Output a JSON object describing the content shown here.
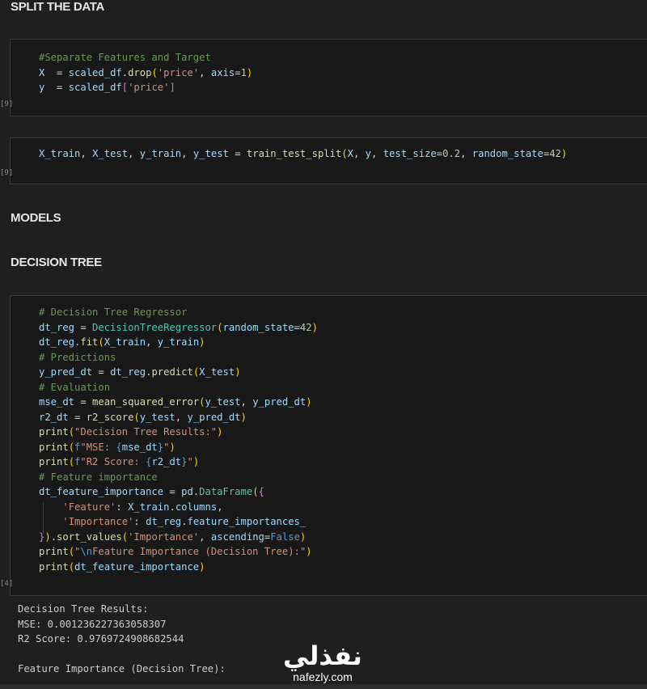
{
  "headings": {
    "split": "SPLIT THE DATA",
    "models": "MODELS",
    "decision_tree": "DECISION TREE"
  },
  "cells": [
    {
      "exec": "[9]",
      "lines": [
        [
          [
            "cm",
            "#Separate Features and Target"
          ]
        ],
        [
          [
            "vr",
            "X"
          ],
          [
            "",
            "  = "
          ],
          [
            "vr",
            "scaled_df"
          ],
          [
            "",
            "."
          ],
          [
            "fn",
            "drop"
          ],
          [
            "pn",
            "("
          ],
          [
            "st",
            "'price'"
          ],
          [
            "",
            ", "
          ],
          [
            "vr",
            "axis"
          ],
          [
            "",
            "="
          ],
          [
            "nm",
            "1"
          ],
          [
            "pn",
            ")"
          ]
        ],
        [
          [
            "vr",
            "y"
          ],
          [
            "",
            "  = "
          ],
          [
            "vr",
            "scaled_df"
          ],
          [
            "pn2",
            "["
          ],
          [
            "st",
            "'price'"
          ],
          [
            "pn2",
            "]"
          ]
        ]
      ]
    },
    {
      "exec": "[9]",
      "lines": [
        [
          [
            "vr",
            "X_train"
          ],
          [
            "",
            ", "
          ],
          [
            "vr",
            "X_test"
          ],
          [
            "",
            ", "
          ],
          [
            "vr",
            "y_train"
          ],
          [
            "",
            ", "
          ],
          [
            "vr",
            "y_test"
          ],
          [
            "",
            " = "
          ],
          [
            "fn",
            "train_test_split"
          ],
          [
            "pn",
            "("
          ],
          [
            "vr",
            "X"
          ],
          [
            "",
            ", "
          ],
          [
            "vr",
            "y"
          ],
          [
            "",
            ", "
          ],
          [
            "vr",
            "test_size"
          ],
          [
            "",
            "="
          ],
          [
            "nm",
            "0.2"
          ],
          [
            "",
            ", "
          ],
          [
            "vr",
            "random_state"
          ],
          [
            "",
            "="
          ],
          [
            "nm",
            "42"
          ],
          [
            "pn",
            ")"
          ]
        ]
      ]
    },
    {
      "exec": "[4]",
      "lines": [
        [
          [
            "cm",
            "# Decision Tree Regressor"
          ]
        ],
        [
          [
            "vr",
            "dt_reg"
          ],
          [
            "",
            " = "
          ],
          [
            "cls",
            "DecisionTreeRegressor"
          ],
          [
            "pn",
            "("
          ],
          [
            "vr",
            "random_state"
          ],
          [
            "",
            "="
          ],
          [
            "nm",
            "42"
          ],
          [
            "pn",
            ")"
          ]
        ],
        [
          [
            "vr",
            "dt_reg"
          ],
          [
            "",
            "."
          ],
          [
            "fn",
            "fit"
          ],
          [
            "pn",
            "("
          ],
          [
            "vr",
            "X_train"
          ],
          [
            "",
            ", "
          ],
          [
            "vr",
            "y_train"
          ],
          [
            "pn",
            ")"
          ]
        ],
        [
          [
            "cm",
            "# Predictions"
          ]
        ],
        [
          [
            "vr",
            "y_pred_dt"
          ],
          [
            "",
            " = "
          ],
          [
            "vr",
            "dt_reg"
          ],
          [
            "",
            "."
          ],
          [
            "fn",
            "predict"
          ],
          [
            "pn",
            "("
          ],
          [
            "vr",
            "X_test"
          ],
          [
            "pn",
            ")"
          ]
        ],
        [
          [
            "cm",
            "# Evaluation"
          ]
        ],
        [
          [
            "vr",
            "mse_dt"
          ],
          [
            "",
            " = "
          ],
          [
            "fn",
            "mean_squared_error"
          ],
          [
            "pn",
            "("
          ],
          [
            "vr",
            "y_test"
          ],
          [
            "",
            ", "
          ],
          [
            "vr",
            "y_pred_dt"
          ],
          [
            "pn",
            ")"
          ]
        ],
        [
          [
            "vr",
            "r2_dt"
          ],
          [
            "",
            " = "
          ],
          [
            "fn",
            "r2_score"
          ],
          [
            "pn",
            "("
          ],
          [
            "vr",
            "y_test"
          ],
          [
            "",
            ", "
          ],
          [
            "vr",
            "y_pred_dt"
          ],
          [
            "pn",
            ")"
          ]
        ],
        [
          [
            "fn",
            "print"
          ],
          [
            "pn",
            "("
          ],
          [
            "st",
            "\"Decision Tree Results:\""
          ],
          [
            "pn",
            ")"
          ]
        ],
        [
          [
            "fn",
            "print"
          ],
          [
            "pn",
            "("
          ],
          [
            "kw",
            "f"
          ],
          [
            "st",
            "\"MSE: "
          ],
          [
            "kw",
            "{"
          ],
          [
            "vr",
            "mse_dt"
          ],
          [
            "kw",
            "}"
          ],
          [
            "st",
            "\""
          ],
          [
            "pn",
            ")"
          ]
        ],
        [
          [
            "fn",
            "print"
          ],
          [
            "pn",
            "("
          ],
          [
            "kw",
            "f"
          ],
          [
            "st",
            "\"R2 Score: "
          ],
          [
            "kw",
            "{"
          ],
          [
            "vr",
            "r2_dt"
          ],
          [
            "kw",
            "}"
          ],
          [
            "st",
            "\""
          ],
          [
            "pn",
            ")"
          ]
        ],
        [
          [
            "cm",
            "# Feature importance"
          ]
        ],
        [
          [
            "vr",
            "dt_feature_importance"
          ],
          [
            "",
            " = "
          ],
          [
            "vr",
            "pd"
          ],
          [
            "",
            "."
          ],
          [
            "cls",
            "DataFrame"
          ],
          [
            "pn",
            "("
          ],
          [
            "pn2",
            "{"
          ]
        ],
        [
          [
            "",
            "    "
          ],
          [
            "st",
            "'Feature'"
          ],
          [
            "",
            ": "
          ],
          [
            "vr",
            "X_train"
          ],
          [
            "",
            "."
          ],
          [
            "vr",
            "columns"
          ],
          [
            "",
            ","
          ]
        ],
        [
          [
            "",
            "    "
          ],
          [
            "st",
            "'Importance'"
          ],
          [
            "",
            ": "
          ],
          [
            "vr",
            "dt_reg"
          ],
          [
            "",
            "."
          ],
          [
            "vr",
            "feature_importances_"
          ]
        ],
        [
          [
            "pn2",
            "}"
          ],
          [
            "pn",
            ")"
          ],
          [
            "",
            "."
          ],
          [
            "fn",
            "sort_values"
          ],
          [
            "pn",
            "("
          ],
          [
            "st",
            "'Importance'"
          ],
          [
            "",
            ", "
          ],
          [
            "vr",
            "ascending"
          ],
          [
            "",
            "="
          ],
          [
            "kw",
            "False"
          ],
          [
            "pn",
            ")"
          ]
        ],
        [
          [
            "fn",
            "print"
          ],
          [
            "pn",
            "("
          ],
          [
            "st",
            "\""
          ],
          [
            "kw",
            "\\n"
          ],
          [
            "st",
            "Feature Importance (Decision Tree):\""
          ],
          [
            "pn",
            ")"
          ]
        ],
        [
          [
            "fn",
            "print"
          ],
          [
            "pn",
            "("
          ],
          [
            "vr",
            "dt_feature_importance"
          ],
          [
            "pn",
            ")"
          ]
        ]
      ]
    }
  ],
  "output": {
    "lines": [
      "Decision Tree Results:",
      "MSE: 0.001236227363058307",
      "R2 Score: 0.9769724908682544",
      "",
      "Feature Importance (Decision Tree):"
    ]
  },
  "watermark": {
    "arabic": "نفذلي",
    "url": "nafezly.com"
  }
}
